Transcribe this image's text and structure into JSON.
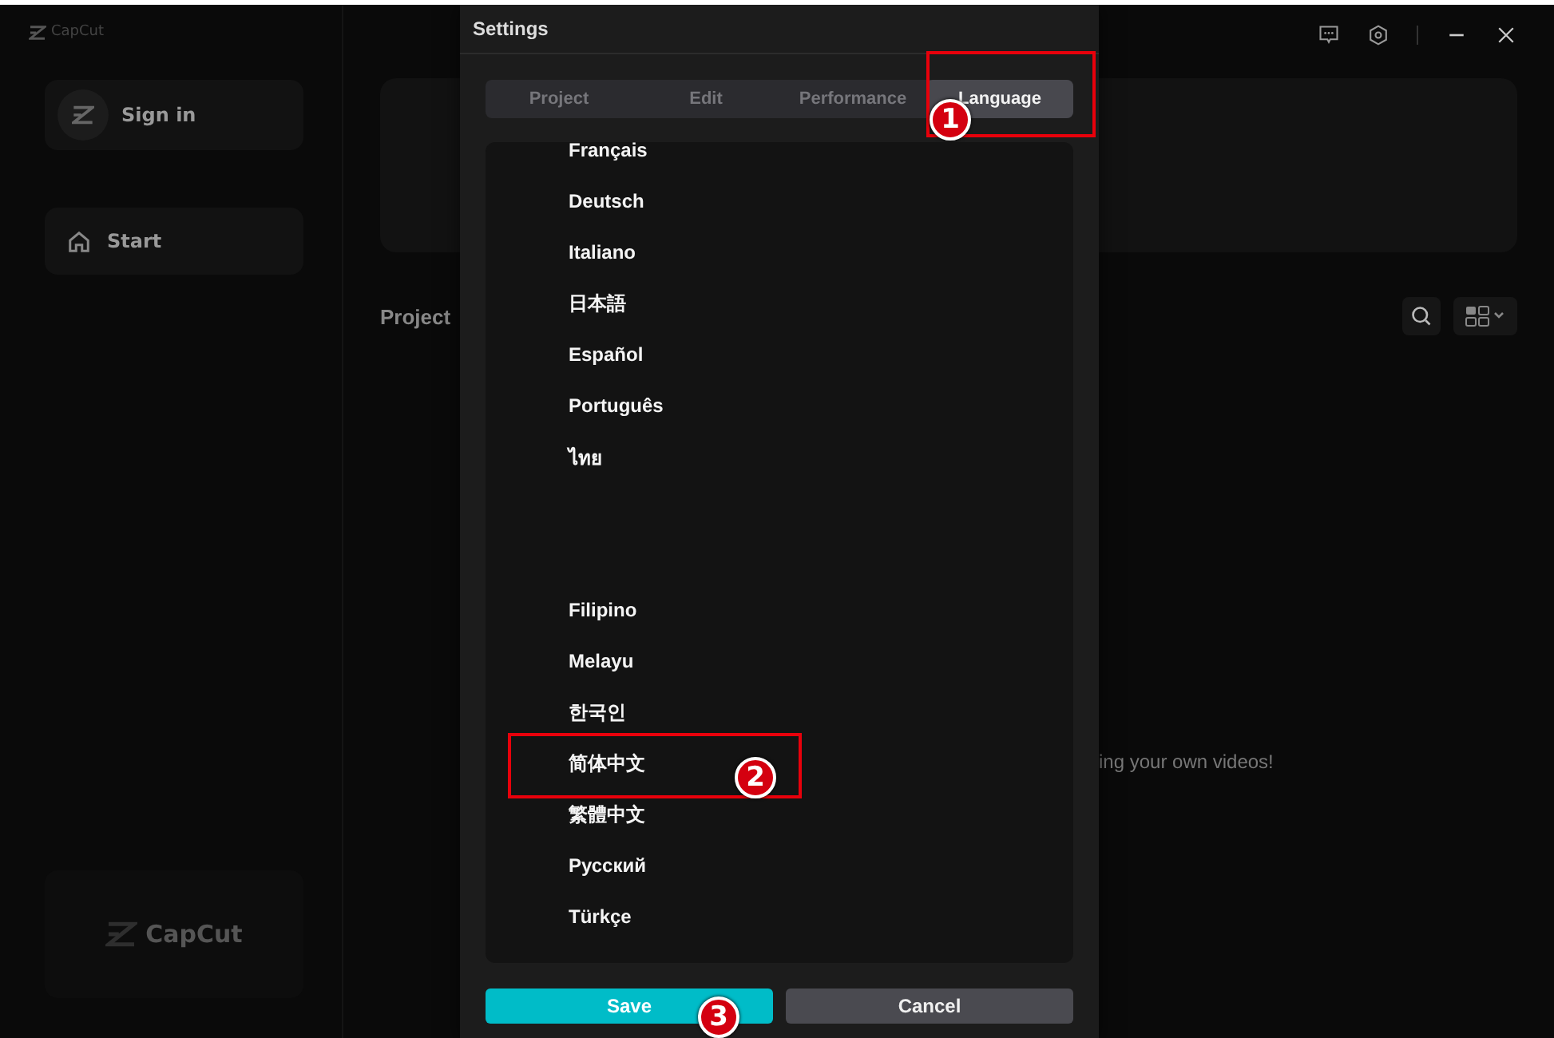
{
  "app": {
    "logo": "CapCut",
    "sidebar": [
      {
        "kind": "signin",
        "label": "Sign in"
      },
      {
        "kind": "nav",
        "label": "Start"
      }
    ],
    "footer_logo": "CapCut",
    "projects_heading": "Project",
    "empty_hint": "ing your own videos!"
  },
  "dialog": {
    "title": "Settings",
    "tabs": [
      {
        "label": "Project",
        "selected": false
      },
      {
        "label": "Edit",
        "selected": false
      },
      {
        "label": "Performance",
        "selected": false
      },
      {
        "label": "Language",
        "selected": true,
        "callout": {
          "number": "1",
          "boxed": true
        }
      }
    ],
    "language_groups": [
      [
        {
          "label": "Français"
        },
        {
          "label": "Deutsch"
        },
        {
          "label": "Italiano"
        },
        {
          "label": "日本語"
        },
        {
          "label": "Español"
        },
        {
          "label": "Português"
        },
        {
          "label": "ไทย"
        }
      ],
      [
        {
          "label": "Filipino"
        },
        {
          "label": "Melayu"
        },
        {
          "label": "한국인"
        },
        {
          "label": "简体中文",
          "callout": {
            "number": "2",
            "boxed": true
          }
        },
        {
          "label": "繁體中文"
        },
        {
          "label": "Русский"
        },
        {
          "label": "Türkçe"
        }
      ]
    ],
    "buttons": [
      {
        "kind": "primary",
        "label": "Save",
        "callout": {
          "number": "3",
          "boxed": false
        }
      },
      {
        "kind": "secondary",
        "label": "Cancel"
      }
    ]
  }
}
